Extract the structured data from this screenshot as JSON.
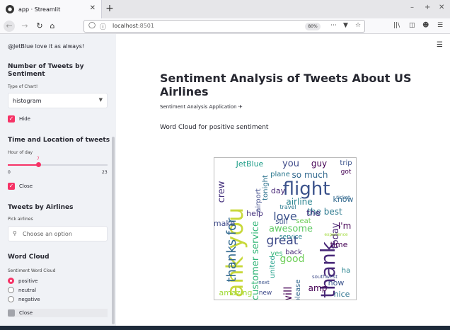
{
  "browser": {
    "tab_title": "app · Streamlit",
    "url_host": "localhost",
    "url_port": ":8501",
    "zoom": "80%"
  },
  "sidebar": {
    "prev_tweet": "@JetBlue love it as always!",
    "tweets_count": {
      "heading": "Number of Tweets by Sentiment",
      "select_label": "Type of Chart!",
      "select_value": "histogram",
      "checkbox_label": "Hide",
      "checked": true
    },
    "time_location": {
      "heading": "Time and Location of tweets",
      "slider_label": "Hour of day",
      "slider_value": 7,
      "slider_min": 0,
      "slider_max": 23,
      "slider_value_label": "7",
      "slider_min_label": "0",
      "slider_max_label": "23",
      "checkbox_label": "Close",
      "checked": true
    },
    "airlines": {
      "heading": "Tweets by Airlines",
      "select_label": "Pick airlines",
      "placeholder": "Choose an option"
    },
    "word_cloud": {
      "heading": "Word Cloud",
      "radio_label": "Sentiment Word Cloud",
      "options": [
        "positive",
        "neutral",
        "negative"
      ],
      "selected": "positive",
      "checkbox_label": "Close",
      "checked": false
    }
  },
  "main": {
    "title": "Sentiment Analysis of Tweets About US Airlines",
    "subtitle": "Sentiment Analysis Application",
    "section": "Word Cloud for positive sentiment",
    "words": [
      {
        "t": "flight",
        "c": "#3b528b"
      },
      {
        "t": "thank you",
        "c": "#c8d83a"
      },
      {
        "t": "thanks for",
        "c": "#31688e"
      },
      {
        "t": "love",
        "c": "#3b528b"
      },
      {
        "t": "great",
        "c": "#3e4a89"
      },
      {
        "t": "thank",
        "c": "#482878"
      },
      {
        "t": "customer service",
        "c": "#35b779"
      },
      {
        "t": "JetBlue",
        "c": "#1f9e89"
      },
      {
        "t": "you",
        "c": "#3e4a89"
      },
      {
        "t": "guy",
        "c": "#440154"
      },
      {
        "t": "so much",
        "c": "#31688e"
      },
      {
        "t": "crew",
        "c": "#46327e"
      },
      {
        "t": "airline",
        "c": "#26828e"
      },
      {
        "t": "the best",
        "c": "#2a788e"
      },
      {
        "t": "today",
        "c": "#482475"
      },
      {
        "t": "good",
        "c": "#6ece58"
      },
      {
        "t": "awesome",
        "c": "#5ec962"
      },
      {
        "t": "amazing",
        "c": "#a0da39"
      },
      {
        "t": "time",
        "c": "#440154"
      },
      {
        "t": "now",
        "c": "#3b528b"
      },
      {
        "t": "nice",
        "c": "#2c728e"
      },
      {
        "t": "amp",
        "c": "#440154"
      },
      {
        "t": "make",
        "c": "#3e4a89"
      },
      {
        "t": "know",
        "c": "#31688e"
      },
      {
        "t": "day",
        "c": "#482878"
      },
      {
        "t": "plane",
        "c": "#2a788e"
      },
      {
        "t": "help",
        "c": "#46327e"
      },
      {
        "t": "still",
        "c": "#3b528b"
      },
      {
        "t": "united",
        "c": "#1f9e89"
      },
      {
        "t": "tonight",
        "c": "#2c728e"
      },
      {
        "t": "airport",
        "c": "#3e4a89"
      },
      {
        "t": "will",
        "c": "#440154"
      },
      {
        "t": "please",
        "c": "#31688e"
      },
      {
        "t": "back",
        "c": "#482878"
      },
      {
        "t": "trip",
        "c": "#3b528b"
      },
      {
        "t": "got",
        "c": "#440154"
      },
      {
        "t": "the",
        "c": "#46327e"
      },
      {
        "t": "I'm",
        "c": "#440154"
      },
      {
        "t": "ha",
        "c": "#26828e"
      },
      {
        "t": "new",
        "c": "#3e4a89"
      },
      {
        "t": "seat",
        "c": "#6ece58"
      },
      {
        "t": "travel",
        "c": "#2a788e"
      },
      {
        "t": "next",
        "c": "#3b528b"
      },
      {
        "t": "ticket",
        "c": "#31688e"
      },
      {
        "t": "yes",
        "c": "#35b779"
      },
      {
        "t": "service",
        "c": "#26828e"
      },
      {
        "t": "southwest",
        "c": "#3e4a89"
      },
      {
        "t": "experience",
        "c": "#a0da39"
      }
    ]
  }
}
